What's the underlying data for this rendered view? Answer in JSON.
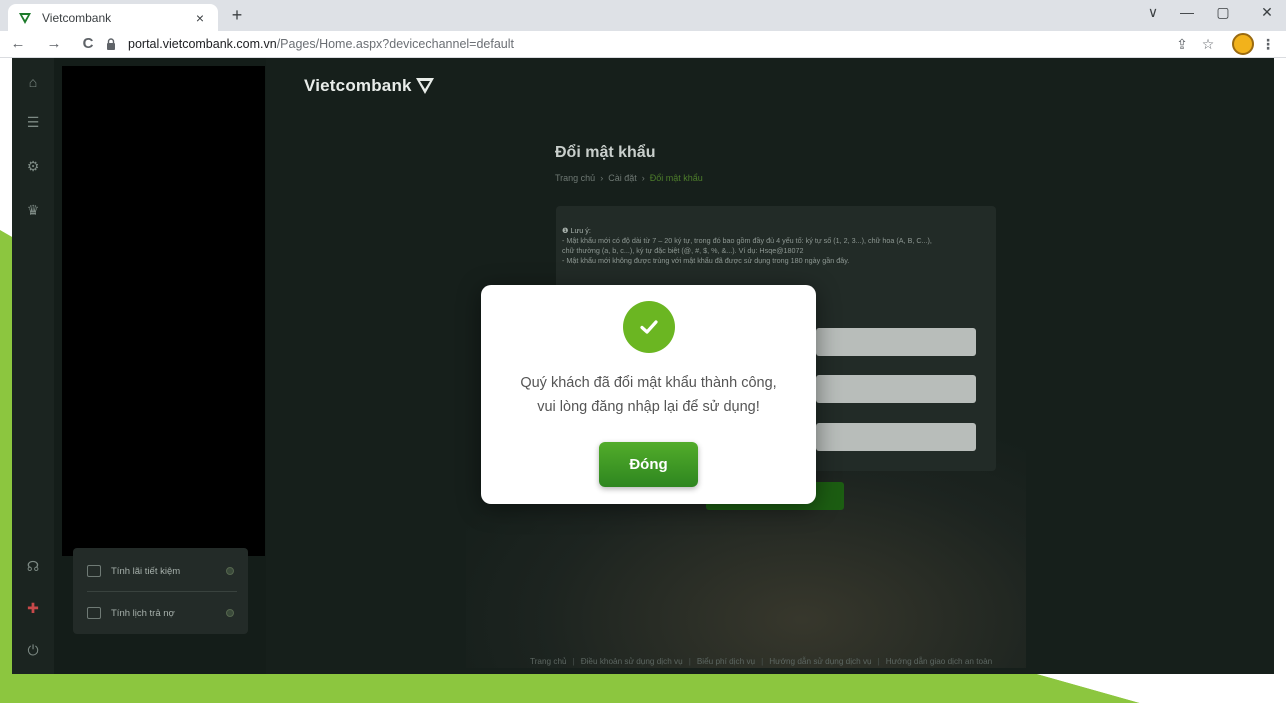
{
  "browser": {
    "tab_title": "Vietcombank",
    "tab_close": "×",
    "new_tab": "+",
    "url_host": "portal.vietcombank.com.vn",
    "url_path": "/Pages/Home.aspx?devicechannel=default",
    "back": "←",
    "forward": "→",
    "reload": "C",
    "share": "⇪",
    "star": "☆",
    "menu": "⋮",
    "chevron": "∨",
    "minimize": "—",
    "maximize": "▢",
    "close_window": "✕"
  },
  "app": {
    "brand": "Vietcombank",
    "page_title": "Đổi mật khẩu",
    "breadcrumb": [
      "Trang chủ",
      "›",
      "Cài đặt",
      "›",
      "Đổi mật khẩu"
    ],
    "note": {
      "heading": "❶ Lưu ý:",
      "line1": "- Mật khẩu mới có độ dài từ 7 – 20 ký tự, trong đó bao gồm đầy đủ 4 yếu tố: ký tự số (1, 2, 3...), chữ hoa (A, B, C...),",
      "line2": "chữ thường (a, b, c...), ký tự đặc biệt (@, #, $, %, &...). Ví dụ: Hsqe@18072",
      "line3": "- Mật khẩu mới không được trùng với mật khẩu đã được sử dụng trong 180 ngày gần đây."
    },
    "side_menu": [
      "Tính lãi tiết kiệm",
      "Tính lịch trả nợ"
    ],
    "footer": [
      "Trang chủ",
      "|",
      "Điều khoản sử dụng dịch vụ",
      "|",
      "Biểu phí dịch vụ",
      "|",
      "Hướng dẫn sử dụng dịch vụ",
      "|",
      "Hướng dẫn giao dịch an toàn"
    ]
  },
  "modal": {
    "message_line1": "Quý khách đã đổi mật khẩu thành công,",
    "message_line2": "vui lòng đăng nhập lại để sử dụng!",
    "button": "Đóng"
  },
  "colors": {
    "accent_green": "#6bb622",
    "button_green": "#2e8620",
    "bg_green": "#8cc63f"
  }
}
